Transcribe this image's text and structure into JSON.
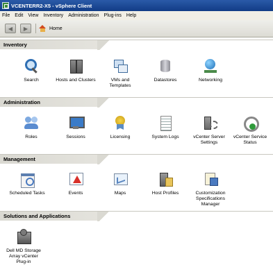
{
  "window": {
    "title": "VCENTERR2-X5 - vSphere Client"
  },
  "menu": [
    "File",
    "Edit",
    "View",
    "Inventory",
    "Administration",
    "Plug-ins",
    "Help"
  ],
  "toolbar": {
    "breadcrumb": "Home",
    "back_glyph": "◀",
    "forward_glyph": "▶"
  },
  "sections": {
    "inventory": {
      "title": "Inventory",
      "items": [
        {
          "label": "Search",
          "icon": "search-icon"
        },
        {
          "label": "Hosts and Clusters",
          "icon": "hosts-clusters-icon"
        },
        {
          "label": "VMs and Templates",
          "icon": "vms-templates-icon"
        },
        {
          "label": "Datastores",
          "icon": "datastores-icon"
        },
        {
          "label": "Networking",
          "icon": "networking-icon"
        }
      ]
    },
    "administration": {
      "title": "Administration",
      "items": [
        {
          "label": "Roles",
          "icon": "roles-icon"
        },
        {
          "label": "Sessions",
          "icon": "sessions-icon"
        },
        {
          "label": "Licensing",
          "icon": "licensing-icon"
        },
        {
          "label": "System Logs",
          "icon": "system-logs-icon"
        },
        {
          "label": "vCenter Server Settings",
          "icon": "vcenter-settings-icon"
        },
        {
          "label": "vCenter Service Status",
          "icon": "vcenter-status-icon"
        }
      ]
    },
    "management": {
      "title": "Management",
      "items": [
        {
          "label": "Scheduled Tasks",
          "icon": "scheduled-tasks-icon"
        },
        {
          "label": "Events",
          "icon": "events-icon"
        },
        {
          "label": "Maps",
          "icon": "maps-icon"
        },
        {
          "label": "Host Profiles",
          "icon": "host-profiles-icon"
        },
        {
          "label": "Customization Specifications Manager",
          "icon": "customization-icon"
        }
      ]
    },
    "solutions": {
      "title": "Solutions and Applications",
      "items": [
        {
          "label": "Dell MD Storage Array vCenter Plug-in",
          "icon": "dell-storage-icon"
        }
      ]
    }
  }
}
